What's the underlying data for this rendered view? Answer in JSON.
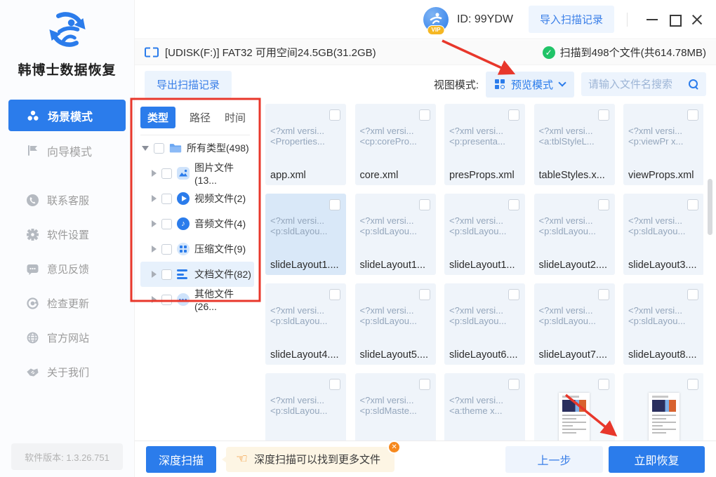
{
  "titlebar": {
    "user_id": "ID: 99YDW",
    "import_button": "导入扫描记录",
    "vip_badge": "VIP"
  },
  "sidebar": {
    "app_name": "韩博士数据恢复",
    "nav": [
      {
        "label": "场景模式",
        "active": true
      },
      {
        "label": "向导模式",
        "active": false
      }
    ],
    "links": [
      {
        "label": "联系客服"
      },
      {
        "label": "软件设置"
      },
      {
        "label": "意见反馈"
      },
      {
        "label": "检查更新"
      },
      {
        "label": "官方网站"
      },
      {
        "label": "关于我们"
      }
    ],
    "version": "软件版本: 1.3.26.751"
  },
  "device_bar": {
    "info": "[UDISK(F:)] FAT32 可用空间24.5GB(31.2GB)",
    "scan_status": "扫描到498个文件(共614.78MB)"
  },
  "toolbar": {
    "export_button": "导出扫描记录",
    "view_mode_label": "视图模式:",
    "view_mode_value": "预览模式",
    "search_placeholder": "请输入文件名搜索"
  },
  "tree": {
    "tabs": [
      "类型",
      "路径",
      "时间"
    ],
    "items": [
      {
        "label": "所有类型(498)",
        "type": "all"
      },
      {
        "label": "图片文件(13...",
        "type": "image"
      },
      {
        "label": "视频文件(2)",
        "type": "video"
      },
      {
        "label": "音频文件(4)",
        "type": "audio"
      },
      {
        "label": "压缩文件(9)",
        "type": "archive"
      },
      {
        "label": "文档文件(82)",
        "type": "document",
        "selected": true
      },
      {
        "label": "其他文件(26...",
        "type": "other"
      }
    ]
  },
  "grid": {
    "cards": [
      {
        "line1": "<?xml versi...",
        "line2": "<Properties...",
        "name": "app.xml"
      },
      {
        "line1": "<?xml versi...",
        "line2": "<cp:corePro...",
        "name": "core.xml"
      },
      {
        "line1": "<?xml versi...",
        "line2": "<p:presenta...",
        "name": "presProps.xml"
      },
      {
        "line1": "<?xml versi...",
        "line2": "<a:tblStyleL...",
        "name": "tableStyles.x..."
      },
      {
        "line1": "<?xml versi...",
        "line2": "<p:viewPr x...",
        "name": "viewProps.xml"
      },
      {
        "line1": "<?xml versi...",
        "line2": "<p:sldLayou...",
        "name": "slideLayout1....",
        "selected": true
      },
      {
        "line1": "<?xml versi...",
        "line2": "<p:sldLayou...",
        "name": "slideLayout1..."
      },
      {
        "line1": "<?xml versi...",
        "line2": "<p:sldLayou...",
        "name": "slideLayout1..."
      },
      {
        "line1": "<?xml versi...",
        "line2": "<p:sldLayou...",
        "name": "slideLayout2...."
      },
      {
        "line1": "<?xml versi...",
        "line2": "<p:sldLayou...",
        "name": "slideLayout3...."
      },
      {
        "line1": "<?xml versi...",
        "line2": "<p:sldLayou...",
        "name": "slideLayout4...."
      },
      {
        "line1": "<?xml versi...",
        "line2": "<p:sldLayou...",
        "name": "slideLayout5...."
      },
      {
        "line1": "<?xml versi...",
        "line2": "<p:sldLayou...",
        "name": "slideLayout6...."
      },
      {
        "line1": "<?xml versi...",
        "line2": "<p:sldLayou...",
        "name": "slideLayout7...."
      },
      {
        "line1": "<?xml versi...",
        "line2": "<p:sldLayou...",
        "name": "slideLayout8...."
      },
      {
        "line1": "<?xml versi...",
        "line2": "<p:sldLayou...",
        "name": ""
      },
      {
        "line1": "<?xml versi...",
        "line2": "<p:sldMaste...",
        "name": ""
      },
      {
        "line1": "<?xml versi...",
        "line2": "<a:theme x...",
        "name": ""
      },
      {
        "thumbnail": true,
        "name": ""
      },
      {
        "thumbnail": true,
        "name": ""
      }
    ]
  },
  "footer": {
    "deep_scan_button": "深度扫描",
    "tip": "深度扫描可以找到更多文件",
    "prev_button": "上一步",
    "recover_button": "立即恢复"
  },
  "colors": {
    "primary": "#2b7ceb",
    "annotation_red": "#e8372b",
    "success_green": "#21c468",
    "tip_orange": "#f6891e"
  }
}
